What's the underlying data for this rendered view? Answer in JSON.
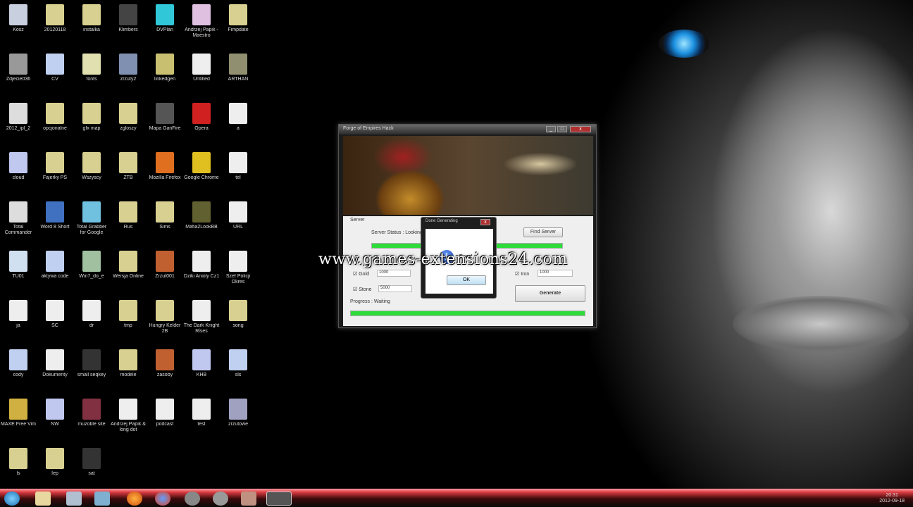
{
  "desktop": {
    "icons": [
      [
        "Kosz",
        "#c8d0e0"
      ],
      [
        "20120118",
        "#d8d090"
      ],
      [
        "instalka",
        "#d8d090"
      ],
      [
        "Klimbers",
        "#444"
      ],
      [
        "DVPlan",
        "#30c8d8"
      ],
      [
        "Andrzej Papik - Maestro",
        "#e0c0e0"
      ],
      [
        "Fimpdate",
        "#d8d090"
      ],
      [
        "Zdjecie036",
        "#999"
      ],
      [
        "CV",
        "#c0d0f0"
      ],
      [
        "fonts",
        "#e0e0b0"
      ],
      [
        "zrzuty2",
        "#8090b0"
      ],
      [
        "linkedgen",
        "#c8c070"
      ],
      [
        "Untitled",
        "#eee"
      ],
      [
        "ARTHAN",
        "#909070"
      ],
      [
        "2012_ipl_2",
        "#ddd"
      ],
      [
        "opcjonalne",
        "#d8d090"
      ],
      [
        "gfx map",
        "#d8d090"
      ],
      [
        "zgloszy",
        "#d8d090"
      ],
      [
        "Mapa GanFire",
        "#555"
      ],
      [
        "Opera",
        "#d02020"
      ],
      [
        "a",
        "#eee"
      ],
      [
        "cloud",
        "#c0c8f0"
      ],
      [
        "Fajerky PS",
        "#d8d090"
      ],
      [
        "Wszyscy",
        "#d8d090"
      ],
      [
        "ZTB",
        "#d8d090"
      ],
      [
        "Mozilla Firefox",
        "#e07020"
      ],
      [
        "Google Chrome",
        "#e0c020"
      ],
      [
        "tel",
        "#eee"
      ],
      [
        "Total Commander",
        "#ddd"
      ],
      [
        "Word 8 Short",
        "#4070c0"
      ],
      [
        "Total Grabber for Google",
        "#70c0e0"
      ],
      [
        "Rus",
        "#d8d090"
      ],
      [
        "Sims",
        "#d8d090"
      ],
      [
        "Mafia2LookBB",
        "#606030"
      ],
      [
        "URL",
        "#eee"
      ],
      [
        "TU01",
        "#d0e0f0"
      ],
      [
        "aktywa code",
        "#c0d0f0"
      ],
      [
        "Win7_do_e",
        "#a0c0a0"
      ],
      [
        "Wersja Online",
        "#d8d090"
      ],
      [
        "Zrzut001",
        "#c06030"
      ],
      [
        "Dziki Anioly Cz1",
        "#eee"
      ],
      [
        "Szef Policji Okres",
        "#eee"
      ],
      [
        "ja",
        "#eee"
      ],
      [
        "SC",
        "#eee"
      ],
      [
        "dr",
        "#eee"
      ],
      [
        "tmp",
        "#d8d090"
      ],
      [
        "Hungry Kelder 2B",
        "#d8d090"
      ],
      [
        "The Dark Knight Rises",
        "#eee"
      ],
      [
        "song",
        "#d8d090"
      ],
      [
        "cody",
        "#c0d0f0"
      ],
      [
        "Dokumenty",
        "#eee"
      ],
      [
        "small seqkey",
        "#333"
      ],
      [
        "modele",
        "#d8d090"
      ],
      [
        "zasoby",
        "#c06030"
      ],
      [
        "KHB",
        "#c0c8f0"
      ],
      [
        "sls",
        "#c0d0f0"
      ],
      [
        "MAXE Free Vim",
        "#d0b040"
      ],
      [
        "NW",
        "#c0c8f0"
      ],
      [
        "muzoble site",
        "#803040"
      ],
      [
        "Andrzej Papik & long dot",
        "#eee"
      ],
      [
        "podcast",
        "#eee"
      ],
      [
        "test",
        "#eee"
      ],
      [
        "zrzutowe",
        "#a0a0c0"
      ],
      [
        "ls",
        "#d8d090"
      ],
      [
        "Iep",
        "#d8d090"
      ],
      [
        "sat",
        "#333"
      ]
    ]
  },
  "app": {
    "title": "Forge of Empires Hack",
    "minimize": "_",
    "maximize": "□",
    "close": "x",
    "server_group": "Server",
    "server_status": "Server Status : Looking...",
    "find_server": "Find Server",
    "gold_label": "Gold",
    "gold_value": "1000",
    "iron_label": "Iron",
    "iron_value": "1000",
    "stone_label": "Stone",
    "stone_value": "5000",
    "generate": "Generate",
    "progress": "Progress : Waiting",
    "progress_top": 1.0,
    "progress_bottom": 1.0
  },
  "dialog": {
    "title": "Done Generating",
    "message": "Done!",
    "ok": "OK",
    "close": "x"
  },
  "watermark": "www.games-extensions24.com",
  "taskbar": {
    "clock_time": "20:31",
    "clock_date": "2012-09-18"
  }
}
